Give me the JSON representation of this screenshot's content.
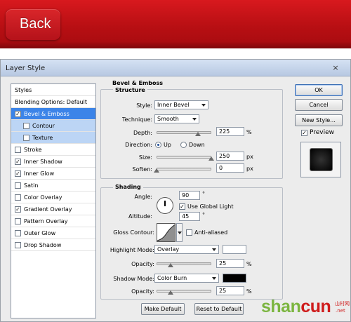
{
  "app": {
    "back_label": "Back"
  },
  "dialog": {
    "title": "Layer Style",
    "close_symbol": "×"
  },
  "styles_list": {
    "header": "Styles",
    "blending_options": "Blending Options: Default",
    "items": [
      {
        "label": "Bevel & Emboss",
        "checked": true,
        "state": "selected"
      },
      {
        "label": "Contour",
        "checked": false,
        "state": "sub"
      },
      {
        "label": "Texture",
        "checked": false,
        "state": "sub"
      },
      {
        "label": "Stroke",
        "checked": false
      },
      {
        "label": "Inner Shadow",
        "checked": true
      },
      {
        "label": "Inner Glow",
        "checked": true
      },
      {
        "label": "Satin",
        "checked": false
      },
      {
        "label": "Color Overlay",
        "checked": false
      },
      {
        "label": "Gradient Overlay",
        "checked": true
      },
      {
        "label": "Pattern Overlay",
        "checked": false
      },
      {
        "label": "Outer Glow",
        "checked": false
      },
      {
        "label": "Drop Shadow",
        "checked": false
      }
    ]
  },
  "bevel": {
    "group_title": "Bevel & Emboss",
    "structure_title": "Structure",
    "style_label": "Style:",
    "style_value": "Inner Bevel",
    "technique_label": "Technique:",
    "technique_value": "Smooth",
    "depth_label": "Depth:",
    "depth_value": "225",
    "depth_unit": "%",
    "depth_slider": 0.75,
    "direction_label": "Direction:",
    "direction_up": "Up",
    "direction_down": "Down",
    "direction_selected": "Up",
    "size_label": "Size:",
    "size_value": "250",
    "size_unit": "px",
    "size_slider": 1.0,
    "soften_label": "Soften:",
    "soften_value": "0",
    "soften_unit": "px",
    "soften_slider": 0.0
  },
  "shading": {
    "title": "Shading",
    "angle_label": "Angle:",
    "angle_value": "90",
    "angle_unit": "°",
    "use_global_light": "Use Global Light",
    "use_global_light_checked": true,
    "altitude_label": "Altitude:",
    "altitude_value": "45",
    "altitude_unit": "°",
    "gloss_contour_label": "Gloss Contour:",
    "anti_aliased": "Anti-aliased",
    "anti_aliased_checked": false,
    "highlight_mode_label": "Highlight Mode:",
    "highlight_mode_value": "Overlay",
    "highlight_color": "#ffffff",
    "highlight_opacity_label": "Opacity:",
    "highlight_opacity_value": "25",
    "highlight_opacity_unit": "%",
    "highlight_opacity_slider": 0.25,
    "shadow_mode_label": "Shadow Mode:",
    "shadow_mode_value": "Color Burn",
    "shadow_color": "#000000",
    "shadow_opacity_label": "Opacity:",
    "shadow_opacity_value": "25",
    "shadow_opacity_unit": "%",
    "shadow_opacity_slider": 0.25
  },
  "buttons": {
    "make_default": "Make Default",
    "reset_default": "Reset to Default",
    "ok": "OK",
    "cancel": "Cancel",
    "new_style": "New Style...",
    "preview": "Preview",
    "preview_checked": true
  },
  "watermark": {
    "part1": "shan",
    "part2": "cun",
    "sub": "山村网",
    "tld": ".net"
  }
}
